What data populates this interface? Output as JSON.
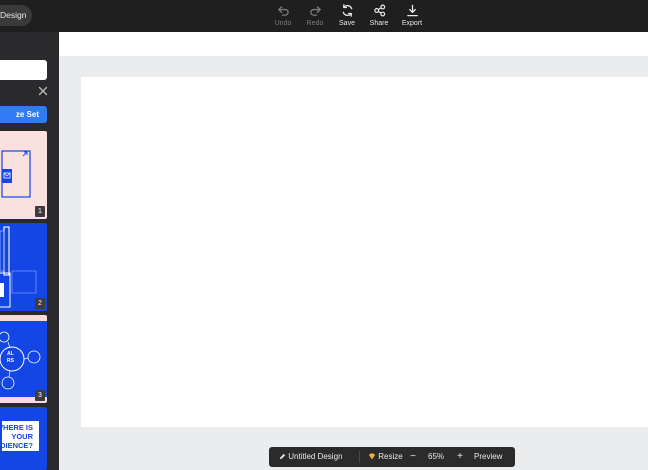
{
  "topbar": {
    "design_button": "Design",
    "tools": [
      {
        "label": "Undo",
        "icon": "undo-icon",
        "enabled": false
      },
      {
        "label": "Redo",
        "icon": "redo-icon",
        "enabled": false
      },
      {
        "label": "Save",
        "icon": "save-icon",
        "enabled": true
      },
      {
        "label": "Share",
        "icon": "share-icon",
        "enabled": true
      },
      {
        "label": "Export",
        "icon": "export-icon",
        "enabled": true
      }
    ]
  },
  "sidebar": {
    "action_button": "ze Set",
    "thumbnails": [
      {
        "number": "1",
        "background": "#fbe0e0"
      },
      {
        "number": "2",
        "background": "#1446e6"
      },
      {
        "number": "3",
        "background": "#f8dadb"
      },
      {
        "number": "",
        "background": "#1446e6",
        "text": "WHERE IS\nYOUR\nAUDIENCE?"
      }
    ],
    "thumb3_labels": [
      "AL",
      "RS"
    ]
  },
  "bottombar": {
    "design_name": "Untitled Design",
    "resize_label": "Resize",
    "zoom_out": "−",
    "zoom_level": "65%",
    "zoom_in": "+",
    "preview_label": "Preview"
  },
  "colors": {
    "accent": "#2f7cf6",
    "toolbar_bg": "#1f1f1f",
    "sidebar_bg": "#2a2a2c",
    "workspace_bg": "#ebecee",
    "slide_blue": "#1446e6"
  }
}
